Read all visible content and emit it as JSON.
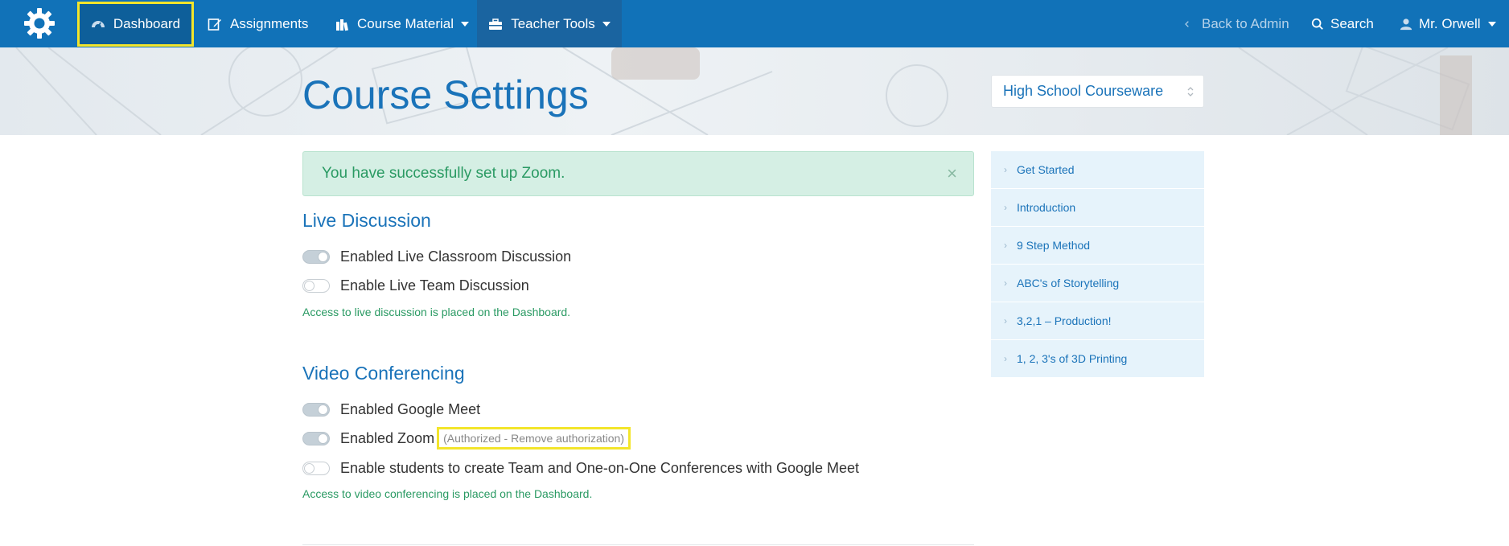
{
  "nav": {
    "dashboard": "Dashboard",
    "assignments": "Assignments",
    "course_material": "Course Material",
    "teacher_tools": "Teacher Tools",
    "back_to_admin": "Back to Admin",
    "search": "Search",
    "user": "Mr. Orwell"
  },
  "hero": {
    "title": "Course Settings",
    "course_select": "High School Courseware"
  },
  "alert": {
    "message": "You have successfully set up Zoom.",
    "close": "×"
  },
  "live_discussion": {
    "title": "Live Discussion",
    "options": [
      {
        "label": "Enabled Live Classroom Discussion",
        "enabled": true
      },
      {
        "label": "Enable Live Team Discussion",
        "enabled": false
      }
    ],
    "note": "Access to live discussion is placed on the Dashboard."
  },
  "video_conferencing": {
    "title": "Video Conferencing",
    "options": [
      {
        "label": "Enabled Google Meet",
        "enabled": true
      },
      {
        "label": "Enabled Zoom",
        "enabled": true
      },
      {
        "label": "Enable students to create Team and One-on-One Conferences with Google Meet",
        "enabled": false
      }
    ],
    "zoom_status": "(Authorized - ",
    "zoom_remove": "Remove authorization",
    "zoom_status_end": ")",
    "note": "Access to video conferencing is placed on the Dashboard."
  },
  "sidebar": {
    "items": [
      {
        "label": "Get Started"
      },
      {
        "label": "Introduction"
      },
      {
        "label": "9 Step Method"
      },
      {
        "label": "ABC's of Storytelling"
      },
      {
        "label": "3,2,1 – Production!"
      },
      {
        "label": "1, 2, 3's of 3D Printing"
      }
    ]
  },
  "colors": {
    "nav_bg": "#1172b8",
    "accent": "#1a73b9",
    "success": "#2a9a63",
    "highlight": "#f3e52b"
  }
}
